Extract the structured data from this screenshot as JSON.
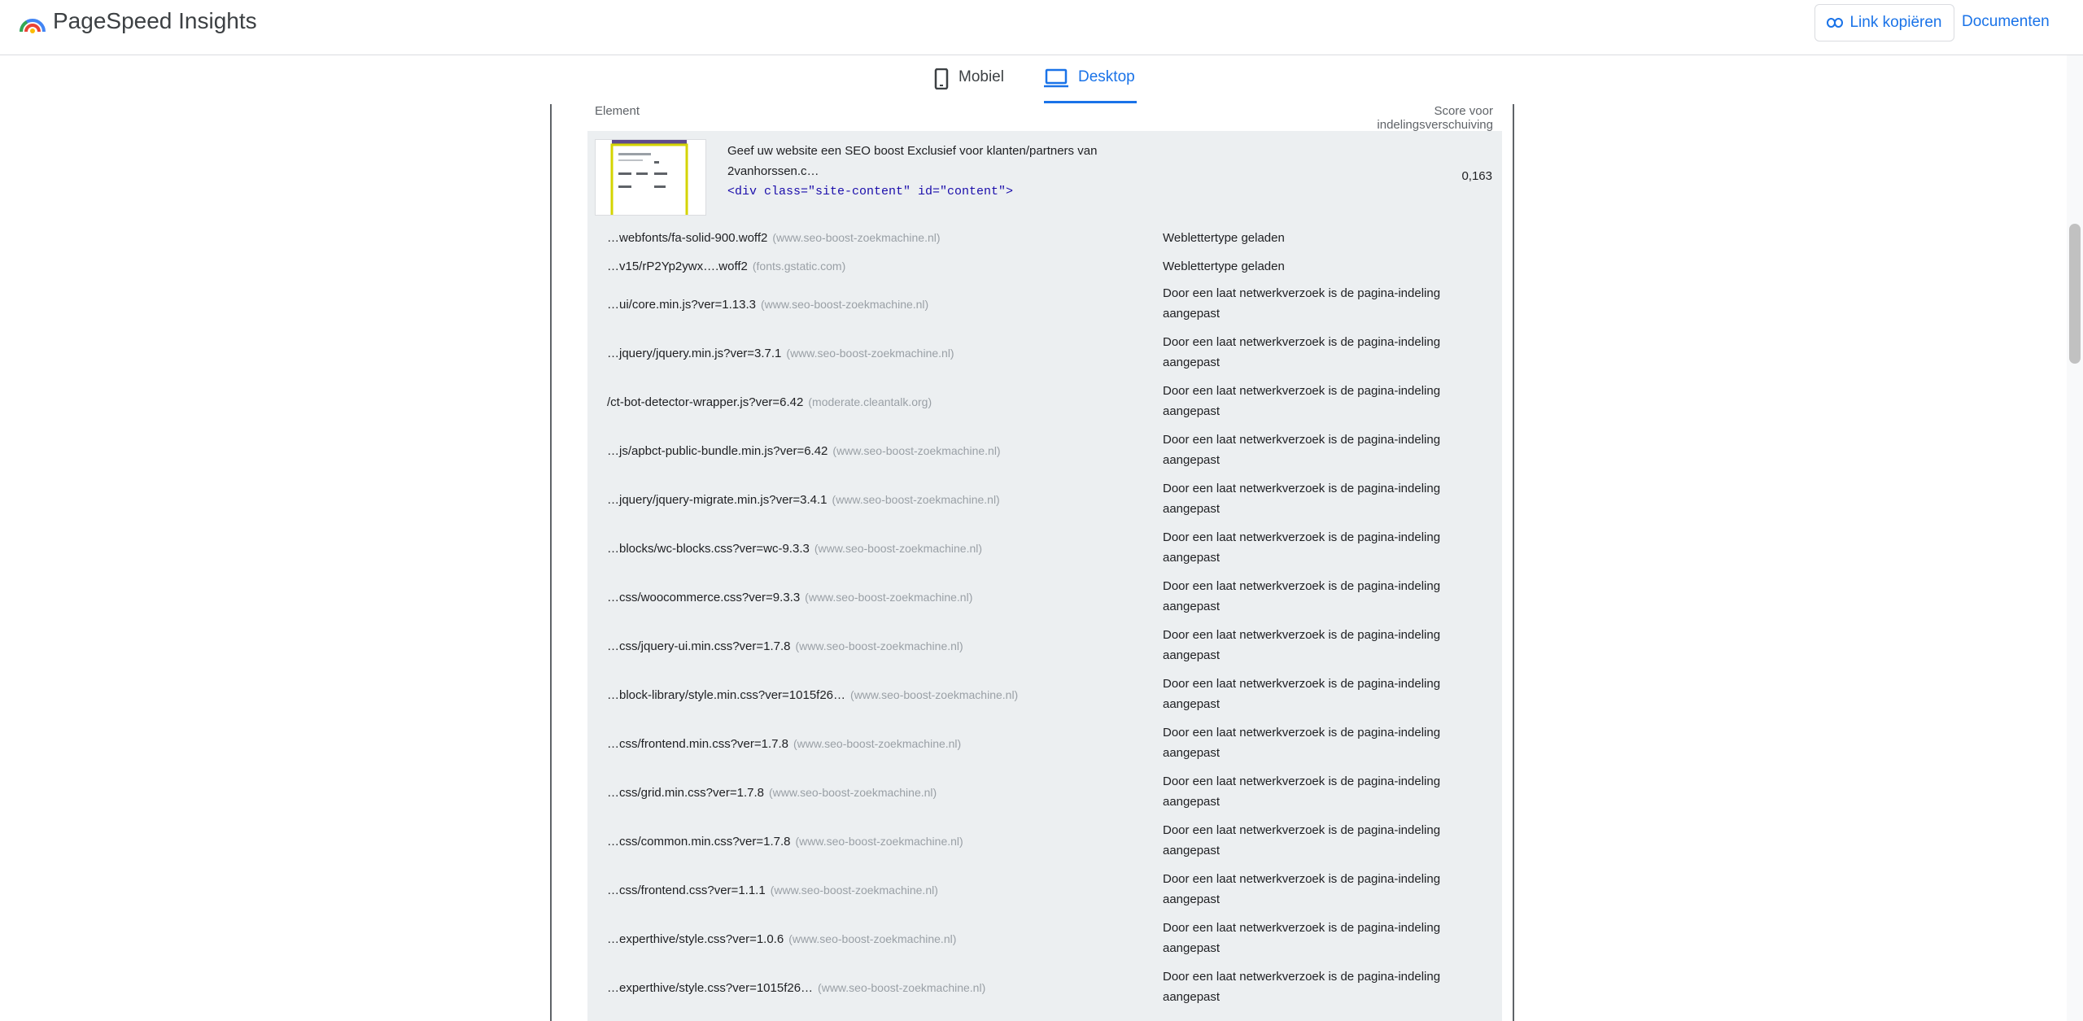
{
  "header": {
    "title": "PageSpeed Insights",
    "copy_link_label": "Link kopiëren",
    "docs_label": "Documenten"
  },
  "tabs": [
    {
      "label": "Mobiel",
      "active": false
    },
    {
      "label": "Desktop",
      "active": true
    }
  ],
  "table": {
    "col_element": "Element",
    "col_score": "Score voor indelingsverschuiving",
    "main": {
      "snippet_line1": "Geef uw website een SEO boost Exclusief voor klanten/partners van",
      "snippet_line2": "2vanhorssen.c…",
      "code": "<div class=\"site-content\" id=\"content\">",
      "score": "0,163"
    },
    "rows": [
      {
        "url": "…webfonts/fa-solid-900.woff2",
        "host": "(www.seo-boost-zoekmachine.nl)",
        "reason": "Weblettertype geladen"
      },
      {
        "url": "…v15/rP2Yp2ywx….woff2",
        "host": "(fonts.gstatic.com)",
        "reason": "Weblettertype geladen"
      },
      {
        "url": "…ui/core.min.js?ver=1.13.3",
        "host": "(www.seo-boost-zoekmachine.nl)",
        "reason": "Door een laat netwerkverzoek is de pagina-indeling aangepast"
      },
      {
        "url": "…jquery/jquery.min.js?ver=3.7.1",
        "host": "(www.seo-boost-zoekmachine.nl)",
        "reason": "Door een laat netwerkverzoek is de pagina-indeling aangepast"
      },
      {
        "url": "/ct-bot-detector-wrapper.js?ver=6.42",
        "host": "(moderate.cleantalk.org)",
        "reason": "Door een laat netwerkverzoek is de pagina-indeling aangepast"
      },
      {
        "url": "…js/apbct-public-bundle.min.js?ver=6.42",
        "host": "(www.seo-boost-zoekmachine.nl)",
        "reason": "Door een laat netwerkverzoek is de pagina-indeling aangepast"
      },
      {
        "url": "…jquery/jquery-migrate.min.js?ver=3.4.1",
        "host": "(www.seo-boost-zoekmachine.nl)",
        "reason": "Door een laat netwerkverzoek is de pagina-indeling aangepast"
      },
      {
        "url": "…blocks/wc-blocks.css?ver=wc-9.3.3",
        "host": "(www.seo-boost-zoekmachine.nl)",
        "reason": "Door een laat netwerkverzoek is de pagina-indeling aangepast"
      },
      {
        "url": "…css/woocommerce.css?ver=9.3.3",
        "host": "(www.seo-boost-zoekmachine.nl)",
        "reason": "Door een laat netwerkverzoek is de pagina-indeling aangepast"
      },
      {
        "url": "…css/jquery-ui.min.css?ver=1.7.8",
        "host": "(www.seo-boost-zoekmachine.nl)",
        "reason": "Door een laat netwerkverzoek is de pagina-indeling aangepast"
      },
      {
        "url": "…block-library/style.min.css?ver=1015f26…",
        "host": "(www.seo-boost-zoekmachine.nl)",
        "reason": "Door een laat netwerkverzoek is de pagina-indeling aangepast"
      },
      {
        "url": "…css/frontend.min.css?ver=1.7.8",
        "host": "(www.seo-boost-zoekmachine.nl)",
        "reason": "Door een laat netwerkverzoek is de pagina-indeling aangepast"
      },
      {
        "url": "…css/grid.min.css?ver=1.7.8",
        "host": "(www.seo-boost-zoekmachine.nl)",
        "reason": "Door een laat netwerkverzoek is de pagina-indeling aangepast"
      },
      {
        "url": "…css/common.min.css?ver=1.7.8",
        "host": "(www.seo-boost-zoekmachine.nl)",
        "reason": "Door een laat netwerkverzoek is de pagina-indeling aangepast"
      },
      {
        "url": "…css/frontend.css?ver=1.1.1",
        "host": "(www.seo-boost-zoekmachine.nl)",
        "reason": "Door een laat netwerkverzoek is de pagina-indeling aangepast"
      },
      {
        "url": "…experthive/style.css?ver=1.0.6",
        "host": "(www.seo-boost-zoekmachine.nl)",
        "reason": "Door een laat netwerkverzoek is de pagina-indeling aangepast"
      },
      {
        "url": "…experthive/style.css?ver=1015f26…",
        "host": "(www.seo-boost-zoekmachine.nl)",
        "reason": "Door een laat netwerkverzoek is de pagina-indeling aangepast"
      }
    ]
  }
}
